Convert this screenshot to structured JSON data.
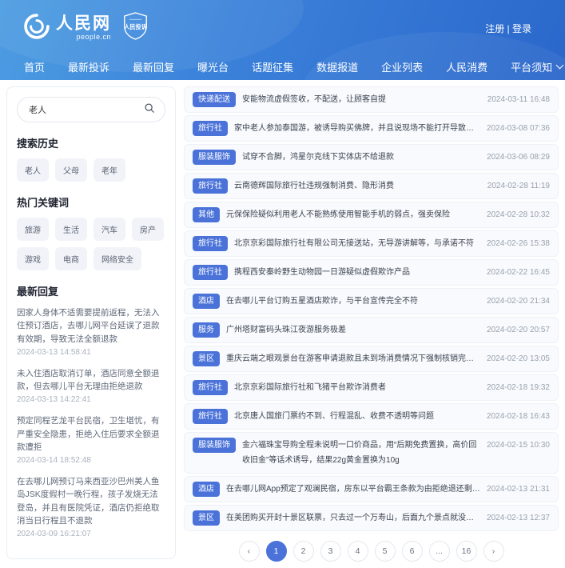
{
  "colors": {
    "accent": "#4a72d9",
    "header_gradient_start": "#4d9de2",
    "header_gradient_end": "#2b67cb",
    "row_bg": "#f8fafd",
    "tag_bg": "#f1f3f8"
  },
  "header": {
    "logo": {
      "name": "人民网",
      "domain": "people.cn"
    },
    "badge_label": "人民投诉",
    "auth": "注册 | 登录",
    "nav": [
      "首页",
      "最新投诉",
      "最新回复",
      "曝光台",
      "话题征集",
      "数据报道",
      "企业列表",
      "人民消费",
      "平台须知"
    ]
  },
  "sidebar": {
    "search": {
      "value": "老人"
    },
    "history": {
      "title": "搜索历史",
      "tags": [
        "老人",
        "父母",
        "老年"
      ]
    },
    "hot": {
      "title": "热门关键词",
      "tags": [
        "旅游",
        "生活",
        "汽车",
        "房产",
        "游戏",
        "电商",
        "网络安全"
      ]
    },
    "replies": {
      "title": "最新回复",
      "items": [
        {
          "text": "因家人身体不适需要提前返程，无法入住预订酒店，去哪儿网平台延误了退款有效期，导致无法全额退款",
          "time": "2024-03-13 14:58:41"
        },
        {
          "text": "未入住酒店取消订单，酒店同意全额退款，但去哪儿平台无理由拒绝退款",
          "time": "2024-03-13 14:22:41"
        },
        {
          "text": "预定同程艺龙平台民宿，卫生堪忧，有严重安全隐患，拒绝入住后要求全额退款遭拒",
          "time": "2024-03-14 18:52:48"
        },
        {
          "text": "在去哪儿网预订马来西亚沙巴州美人鱼岛JSK度假村一晚行程，孩子发烧无法登岛，并且有医院凭证，酒店仍拒绝取消当日行程且不退款",
          "time": "2024-03-09 16:21:07"
        }
      ]
    }
  },
  "main": {
    "items": [
      {
        "category": "快递配送",
        "title": "安能物流虚假签收，不配送，让顾客自提",
        "time": "2024-03-11 16:48"
      },
      {
        "category": "旅行社",
        "title": "家中老人参加泰国游，被诱导购买佛牌，并且说现场不能打开导致无法验货，退货被拒",
        "time": "2024-03-08 07:36"
      },
      {
        "category": "服装服饰",
        "title": "试穿不合脚，鸿星尔克线下实体店不给退款",
        "time": "2024-03-06 08:29"
      },
      {
        "category": "旅行社",
        "title": "云南德辉国际旅行社违规强制消费、隐形消费",
        "time": "2024-02-28 11:19"
      },
      {
        "category": "其他",
        "title": "元保保险疑似利用老人不能熟练使用智能手机的弱点，强卖保险",
        "time": "2024-02-28 10:32"
      },
      {
        "category": "旅行社",
        "title": "北京京彩国际旅行社有限公司无接送站，无导游讲解等，与承诺不符",
        "time": "2024-02-26 15:38"
      },
      {
        "category": "旅行社",
        "title": "携程西安秦岭野生动物园一日游疑似虚假欺诈产品",
        "time": "2024-02-22 16:45"
      },
      {
        "category": "酒店",
        "title": "在去哪儿平台订购五星酒店欺诈，与平台宣传完全不符",
        "time": "2024-02-20 21:34"
      },
      {
        "category": "服务",
        "title": "广州塔财富码头珠江夜游服务极差",
        "time": "2024-02-20 20:57"
      },
      {
        "category": "景区",
        "title": "重庆云端之眼观景台在游客申请退款且未到场消费情况下强制核销完成订单",
        "time": "2024-02-20 13:05"
      },
      {
        "category": "旅行社",
        "title": "北京京彩国际旅行社和飞猪平台欺诈消费者",
        "time": "2024-02-18 19:32"
      },
      {
        "category": "旅行社",
        "title": "北京唐人国旅门票约不到、行程混乱、收费不透明等问题",
        "time": "2024-02-18 16:43"
      },
      {
        "category": "服装服饰",
        "title": "金六福珠宝导购全程未说明一口价商品，用“后期免费置换，高价回收旧金”等话术诱导，结果22g黄金置换为10g",
        "time": "2024-02-15 10:30",
        "wrap": true
      },
      {
        "category": "酒店",
        "title": "在去哪儿网App预定了观澜民宿，房东以平台霸王条款为由拒绝退还剩余费用",
        "time": "2024-02-13 21:31"
      },
      {
        "category": "景区",
        "title": "在美团购买开封十景区联票，只去过一个万寿山，后面九个景点就没法使用了",
        "time": "2024-02-13 12:37"
      }
    ],
    "pagination": {
      "prev": "‹",
      "next": "›",
      "pages": [
        "1",
        "2",
        "3",
        "4",
        "5",
        "6",
        "...",
        "16"
      ],
      "active": "1"
    }
  }
}
